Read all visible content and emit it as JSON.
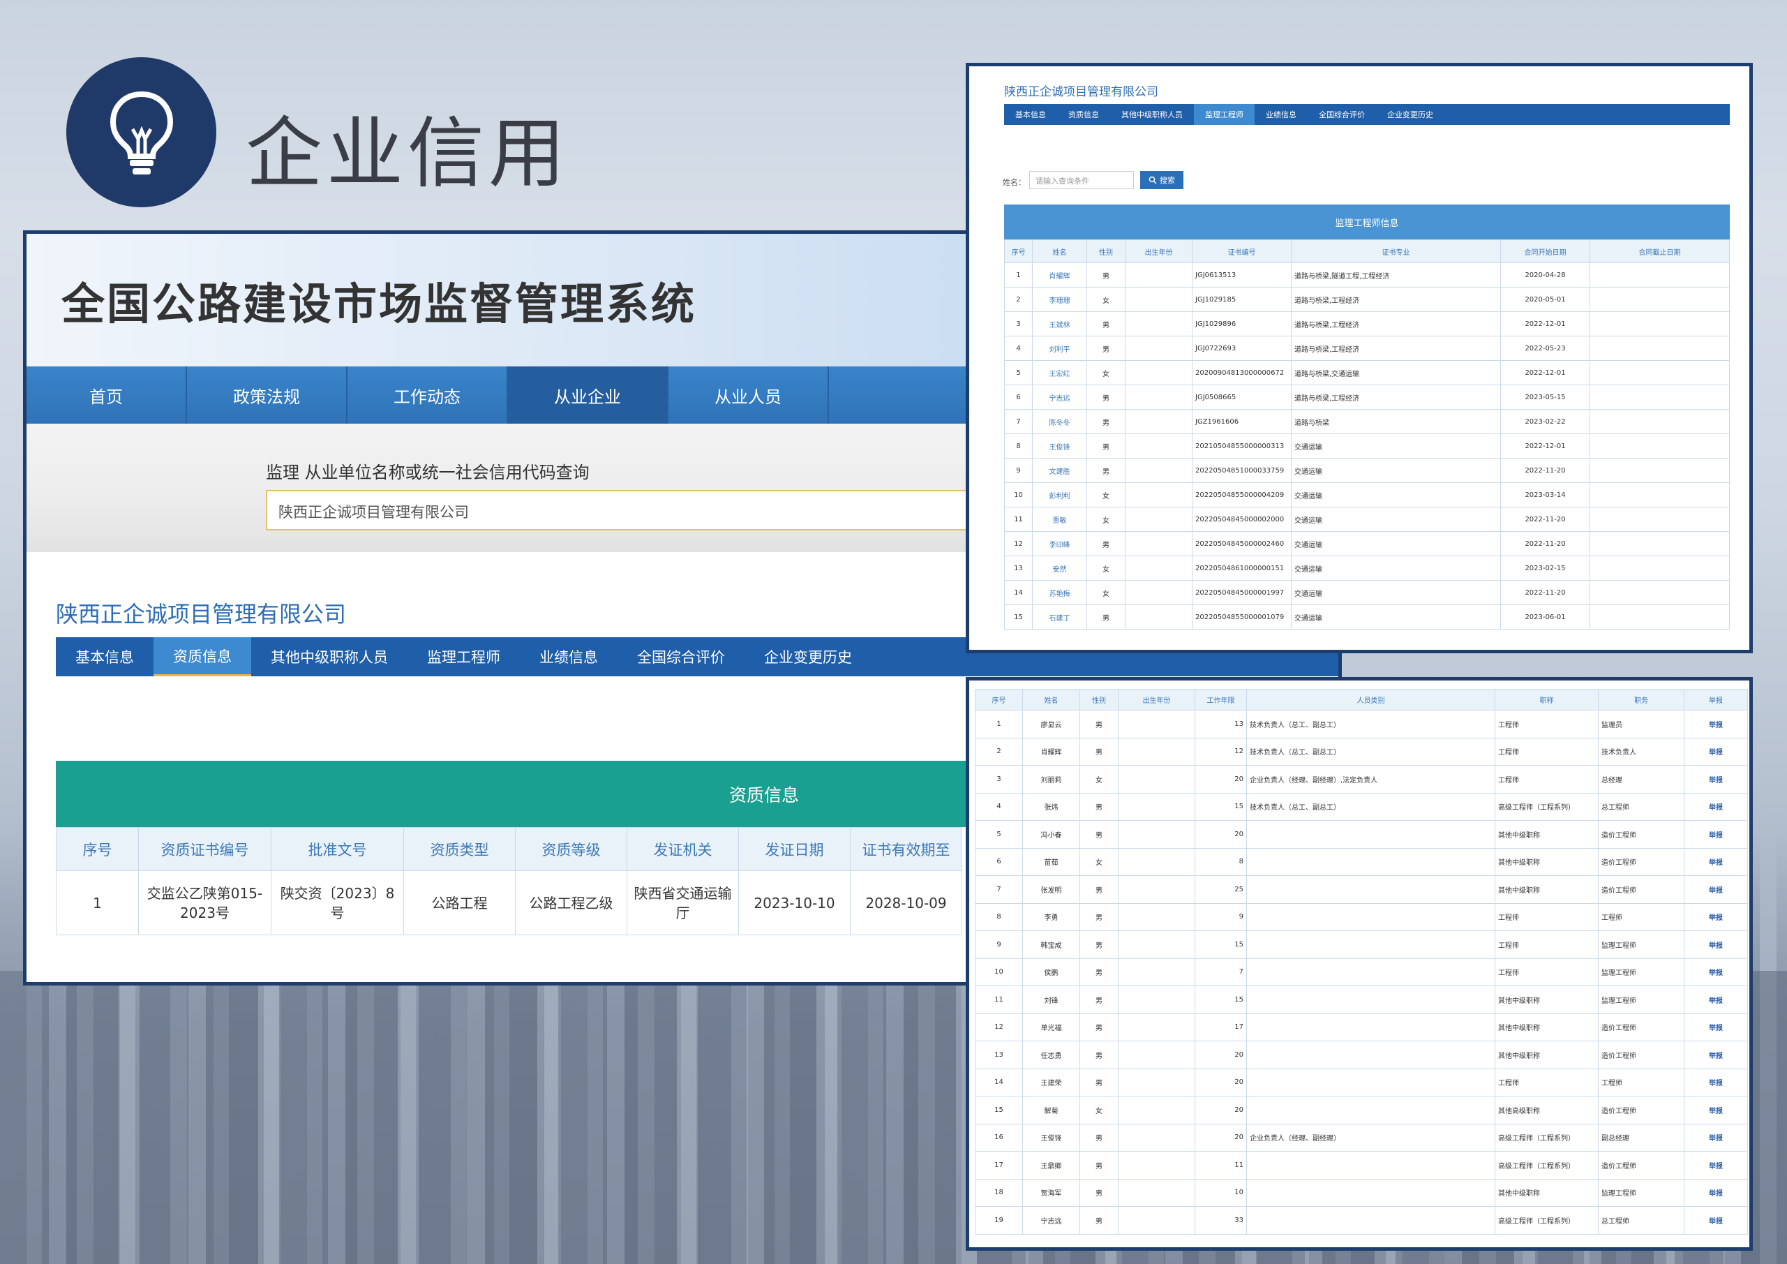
{
  "slide": {
    "title": "企业信用"
  },
  "left": {
    "system_title": "全国公路建设市场监督管理系统",
    "nav": [
      "首页",
      "政策法规",
      "工作动态",
      "从业企业",
      "从业人员"
    ],
    "search_label": "监理 从业单位名称或统一社会信用代码查询",
    "search_value": "陕西正企诚项目管理有限公司",
    "company": "陕西正企诚项目管理有限公司",
    "tabs": [
      "基本信息",
      "资质信息",
      "其他中级职称人员",
      "监理工程师",
      "业绩信息",
      "全国综合评价",
      "企业变更历史"
    ],
    "table_caption": "资质信息",
    "headers": [
      "序号",
      "资质证书编号",
      "批准文号",
      "资质类型",
      "资质等级",
      "发证机关",
      "发证日期",
      "证书有效期至"
    ],
    "rows": [
      [
        "1",
        "交监公乙陕第015-2023号",
        "陕交资〔2023〕8号",
        "公路工程",
        "公路工程乙级",
        "陕西省交通运输厅",
        "2023-10-10",
        "2028-10-09"
      ]
    ]
  },
  "right_top": {
    "company": "陕西正企诚项目管理有限公司",
    "tabs": [
      "基本信息",
      "资质信息",
      "其他中级职称人员",
      "监理工程师",
      "业绩信息",
      "全国综合评价",
      "企业变更历史"
    ],
    "search_label": "姓名：",
    "search_placeholder": "请输入查询条件",
    "search_button": "搜索",
    "table_caption": "监理工程师信息",
    "headers": [
      "序号",
      "姓名",
      "性别",
      "出生年份",
      "证书编号",
      "证书专业",
      "合同开始日期",
      "合同截止日期"
    ],
    "rows": [
      [
        "1",
        "肖耀辉",
        "男",
        "",
        "JGJ0613513",
        "道路与桥梁,隧道工程,工程经济",
        "2020-04-28",
        ""
      ],
      [
        "2",
        "李珊珊",
        "女",
        "",
        "JGJ1029185",
        "道路与桥梁,工程经济",
        "2020-05-01",
        ""
      ],
      [
        "3",
        "王斌林",
        "男",
        "",
        "JGJ1029896",
        "道路与桥梁,工程经济",
        "2022-12-01",
        ""
      ],
      [
        "4",
        "刘利平",
        "男",
        "",
        "JGJ0722693",
        "道路与桥梁,工程经济",
        "2022-05-23",
        ""
      ],
      [
        "5",
        "王宏红",
        "女",
        "",
        "20200904813000000672",
        "道路与桥梁,交通运输",
        "2022-12-01",
        ""
      ],
      [
        "6",
        "宁志远",
        "男",
        "",
        "JGJ0508665",
        "道路与桥梁,工程经济",
        "2023-05-15",
        ""
      ],
      [
        "7",
        "陈冬冬",
        "男",
        "",
        "JGZ1961606",
        "道路与桥梁",
        "2023-02-22",
        ""
      ],
      [
        "8",
        "王俊锋",
        "男",
        "",
        "20210504855000000313",
        "交通运输",
        "2022-12-01",
        ""
      ],
      [
        "9",
        "文建胜",
        "男",
        "",
        "20220504851000033759",
        "交通运输",
        "2022-11-20",
        ""
      ],
      [
        "10",
        "彭利利",
        "女",
        "",
        "20220504855000004209",
        "交通运输",
        "2023-03-14",
        ""
      ],
      [
        "11",
        "贾敏",
        "女",
        "",
        "20220504845000002000",
        "交通运输",
        "2022-11-20",
        ""
      ],
      [
        "12",
        "李印峰",
        "男",
        "",
        "20220504845000002460",
        "交通运输",
        "2022-11-20",
        ""
      ],
      [
        "13",
        "安然",
        "女",
        "",
        "20220504861000000151",
        "交通运输",
        "2023-02-15",
        ""
      ],
      [
        "14",
        "苏艳梅",
        "女",
        "",
        "20220504845000001997",
        "交通运输",
        "2022-11-20",
        ""
      ],
      [
        "15",
        "石建丁",
        "男",
        "",
        "20220504855000001079",
        "交通运输",
        "2023-06-01",
        ""
      ]
    ]
  },
  "right_bottom": {
    "headers": [
      "序号",
      "姓名",
      "性别",
      "出生年份",
      "工作年限",
      "人员类别",
      "职称",
      "职务",
      "举报"
    ],
    "rows": [
      [
        "1",
        "廖显云",
        "男",
        "",
        "13",
        "技术负责人（总工、副总工）",
        "工程师",
        "监理员",
        "举报"
      ],
      [
        "2",
        "肖耀辉",
        "男",
        "",
        "12",
        "技术负责人（总工、副总工）",
        "工程师",
        "技术负责人",
        "举报"
      ],
      [
        "3",
        "刘丽莉",
        "女",
        "",
        "20",
        "企业负责人（经理、副经理）,法定负责人",
        "工程师",
        "总经理",
        "举报"
      ],
      [
        "4",
        "张炜",
        "男",
        "",
        "15",
        "技术负责人（总工、副总工）",
        "高级工程师（工程系列）",
        "总工程师",
        "举报"
      ],
      [
        "5",
        "冯小春",
        "男",
        "",
        "20",
        "",
        "其他中级职称",
        "造价工程师",
        "举报"
      ],
      [
        "6",
        "苗茹",
        "女",
        "",
        "8",
        "",
        "其他中级职称",
        "造价工程师",
        "举报"
      ],
      [
        "7",
        "张发明",
        "男",
        "",
        "25",
        "",
        "其他中级职称",
        "造价工程师",
        "举报"
      ],
      [
        "8",
        "李勇",
        "男",
        "",
        "9",
        "",
        "工程师",
        "工程师",
        "举报"
      ],
      [
        "9",
        "韩宝成",
        "男",
        "",
        "15",
        "",
        "工程师",
        "监理工程师",
        "举报"
      ],
      [
        "10",
        "侯鹏",
        "男",
        "",
        "7",
        "",
        "工程师",
        "监理工程师",
        "举报"
      ],
      [
        "11",
        "刘锋",
        "男",
        "",
        "15",
        "",
        "其他中级职称",
        "监理工程师",
        "举报"
      ],
      [
        "12",
        "单光福",
        "男",
        "",
        "17",
        "",
        "其他中级职称",
        "造价工程师",
        "举报"
      ],
      [
        "13",
        "任志勇",
        "男",
        "",
        "20",
        "",
        "其他中级职称",
        "造价工程师",
        "举报"
      ],
      [
        "14",
        "王建荣",
        "男",
        "",
        "20",
        "",
        "工程师",
        "工程师",
        "举报"
      ],
      [
        "15",
        "解菊",
        "女",
        "",
        "20",
        "",
        "其他高级职称",
        "造价工程师",
        "举报"
      ],
      [
        "16",
        "王俊锋",
        "男",
        "",
        "20",
        "企业负责人（经理、副经理）",
        "高级工程师（工程系列）",
        "副总经理",
        "举报"
      ],
      [
        "17",
        "王鼎卿",
        "男",
        "",
        "11",
        "",
        "高级工程师（工程系列）",
        "造价工程师",
        "举报"
      ],
      [
        "18",
        "贺海军",
        "男",
        "",
        "10",
        "",
        "其他中级职称",
        "监理工程师",
        "举报"
      ],
      [
        "19",
        "宁志远",
        "男",
        "",
        "33",
        "",
        "高级工程师（工程系列）",
        "总工程师",
        "举报"
      ]
    ]
  },
  "colors": {
    "navy": "#1f3a68",
    "nav_blue": "#2f73b8",
    "teal": "#1aa090",
    "tab_blue": "#1f5ea8"
  },
  "icons": {
    "slide_icon": "lightbulb-icon",
    "search_button_icon": "search-icon"
  }
}
